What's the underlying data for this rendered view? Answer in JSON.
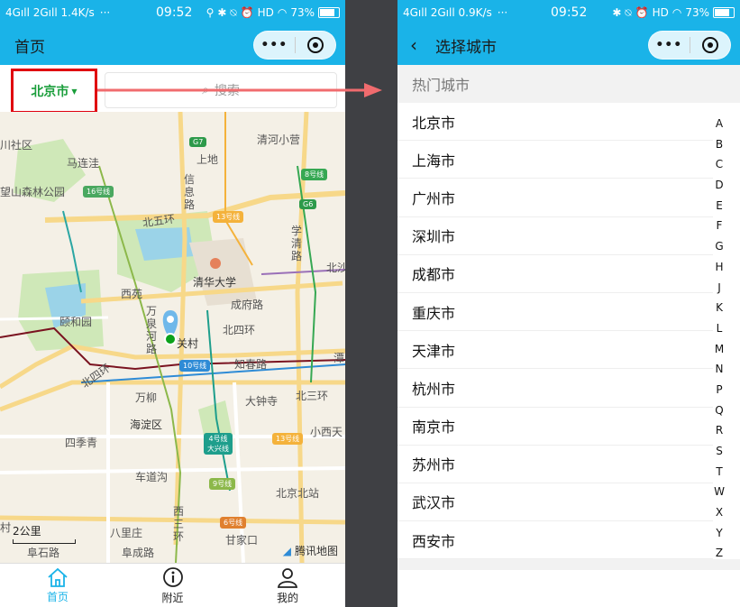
{
  "left_screen": {
    "status": {
      "network_left": "4Gıll 2Gıll 1.4K/s",
      "dots": "···",
      "time": "09:52",
      "hd": "HD",
      "battery": "73%"
    },
    "navbar": {
      "title": "首页"
    },
    "city_button": {
      "label": "北京市"
    },
    "search": {
      "placeholder": "搜索"
    },
    "map": {
      "labels": [
        "川社区",
        "马连洼",
        "望山森林公园",
        "上地",
        "信息路",
        "清河小营",
        "北五环",
        "学清路",
        "北沙",
        "清华大学",
        "西苑",
        "成府路",
        "颐和园",
        "万泉河路",
        "北四环",
        "关村",
        "北四环",
        "知春路",
        "万柳",
        "大钟寺",
        "北三环",
        "海淀区",
        "四季青",
        "小西天",
        "车道沟",
        "北京北站",
        "村",
        "八里庄",
        "西三环",
        "甘家口",
        "阜石路",
        "阜成路",
        "潭"
      ],
      "badges": [
        "G7",
        "8号线",
        "16号线",
        "13号线",
        "G6",
        "10号线",
        "4号线\n大兴线",
        "13号线",
        "9号线",
        "6号线"
      ],
      "scale": "2公里",
      "provider": "腾讯地图"
    },
    "tabs": [
      {
        "label": "首页"
      },
      {
        "label": "附近"
      },
      {
        "label": "我的"
      }
    ]
  },
  "right_screen": {
    "status": {
      "network_left": "4Gıll 2Gıll 0.9K/s",
      "dots": "···",
      "time": "09:52",
      "hd": "HD",
      "battery": "73%"
    },
    "navbar": {
      "title": "选择城市"
    },
    "section": "热门城市",
    "cities": [
      "北京市",
      "上海市",
      "广州市",
      "深圳市",
      "成都市",
      "重庆市",
      "天津市",
      "杭州市",
      "南京市",
      "苏州市",
      "武汉市",
      "西安市"
    ],
    "index_letters": [
      "A",
      "B",
      "C",
      "D",
      "E",
      "F",
      "G",
      "H",
      "J",
      "K",
      "L",
      "M",
      "N",
      "P",
      "Q",
      "R",
      "S",
      "T",
      "W",
      "X",
      "Y",
      "Z"
    ]
  },
  "colors": {
    "header": "#1ab3e8",
    "city_green": "#1a9e3b",
    "highlight": "#e0000f",
    "arrow": "#f06b6e"
  }
}
